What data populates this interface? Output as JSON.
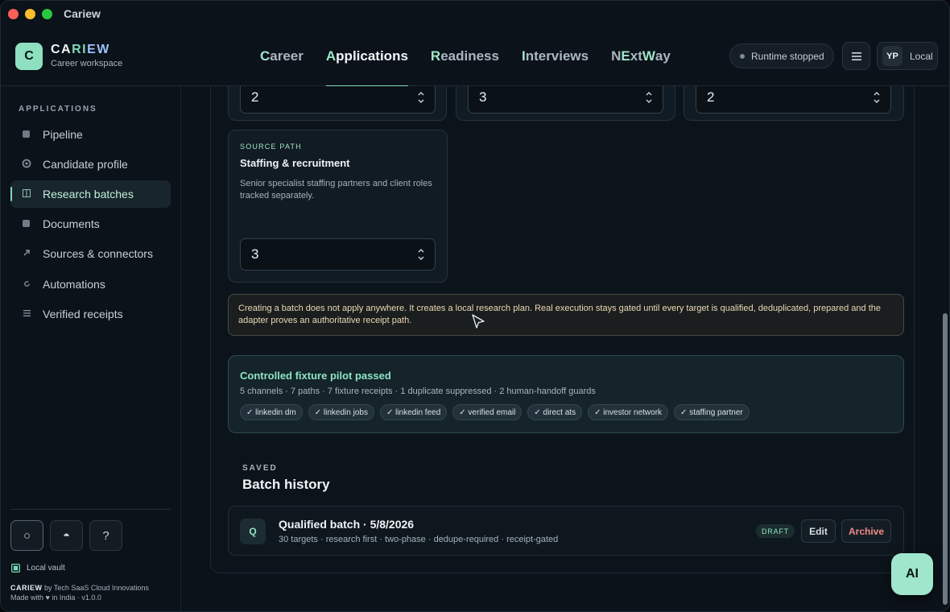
{
  "window": {
    "title": "Cariew"
  },
  "brand": {
    "logo_letter": "C",
    "name_a": "CA",
    "name_b": "RI",
    "name_c": "EW",
    "subtitle": "Career workspace"
  },
  "nav": {
    "items": [
      {
        "first": "C",
        "rest": "areer"
      },
      {
        "first": "A",
        "rest": "pplications"
      },
      {
        "first": "R",
        "rest": "eadiness"
      },
      {
        "first": "I",
        "rest": "nterviews"
      },
      {
        "first": "N",
        "mid": "E",
        "midrest": "xt ",
        "w": "W",
        "rest": "ay"
      }
    ],
    "active_index": 1
  },
  "header": {
    "runtime_status": "Runtime stopped",
    "menu_icon": "hamburger-icon",
    "user_initials": "YP",
    "user_mode": "Local"
  },
  "sidebar": {
    "heading": "APPLICATIONS",
    "items": [
      {
        "label": "Pipeline",
        "icon": "square-icon"
      },
      {
        "label": "Candidate profile",
        "icon": "circle-icon"
      },
      {
        "label": "Research batches",
        "icon": "columns-icon",
        "active": true
      },
      {
        "label": "Documents",
        "icon": "square-icon"
      },
      {
        "label": "Sources & connectors",
        "icon": "arrow-up-right-icon"
      },
      {
        "label": "Automations",
        "icon": "refresh-icon"
      },
      {
        "label": "Verified receipts",
        "icon": "list-icon"
      }
    ],
    "tools": {
      "t1": "○",
      "t2": "◓",
      "t3": "?"
    },
    "vault_label": "Local vault",
    "footer_brand": "CARIEW",
    "footer_by": " by Tech SaaS Cloud Innovations",
    "footer_line2": "Made with ♥ in India · v1.0.0"
  },
  "steppers_top": [
    "2",
    "3",
    "2"
  ],
  "source_card": {
    "eyebrow": "SOURCE PATH",
    "title": "Staffing & recruitment",
    "description": "Senior specialist staffing partners and client roles tracked separately.",
    "value": "3"
  },
  "notice": "Creating a batch does not apply anywhere. It creates a local research plan. Real execution stays gated until every target is qualified, deduplicated, prepared and the adapter proves an authoritative receipt path.",
  "pilot": {
    "title": "Controlled fixture pilot passed",
    "meta": "5 channels · 7 paths · 7 fixture receipts · 1 duplicate suppressed · 2 human-handoff guards",
    "chips": [
      "✓ linkedin dm",
      "✓ linkedin jobs",
      "✓ linkedin feed",
      "✓ verified email",
      "✓ direct ats",
      "✓ investor network",
      "✓ staffing partner"
    ]
  },
  "history": {
    "eyebrow": "SAVED",
    "title": "Batch history",
    "batch": {
      "initial": "Q",
      "title": "Qualified batch · 5/8/2026",
      "meta": "30 targets · research first · two-phase · dedupe-required · receipt-gated",
      "status": "DRAFT",
      "edit_label": "Edit",
      "archive_label": "Archive"
    }
  },
  "ai_button": "AI"
}
